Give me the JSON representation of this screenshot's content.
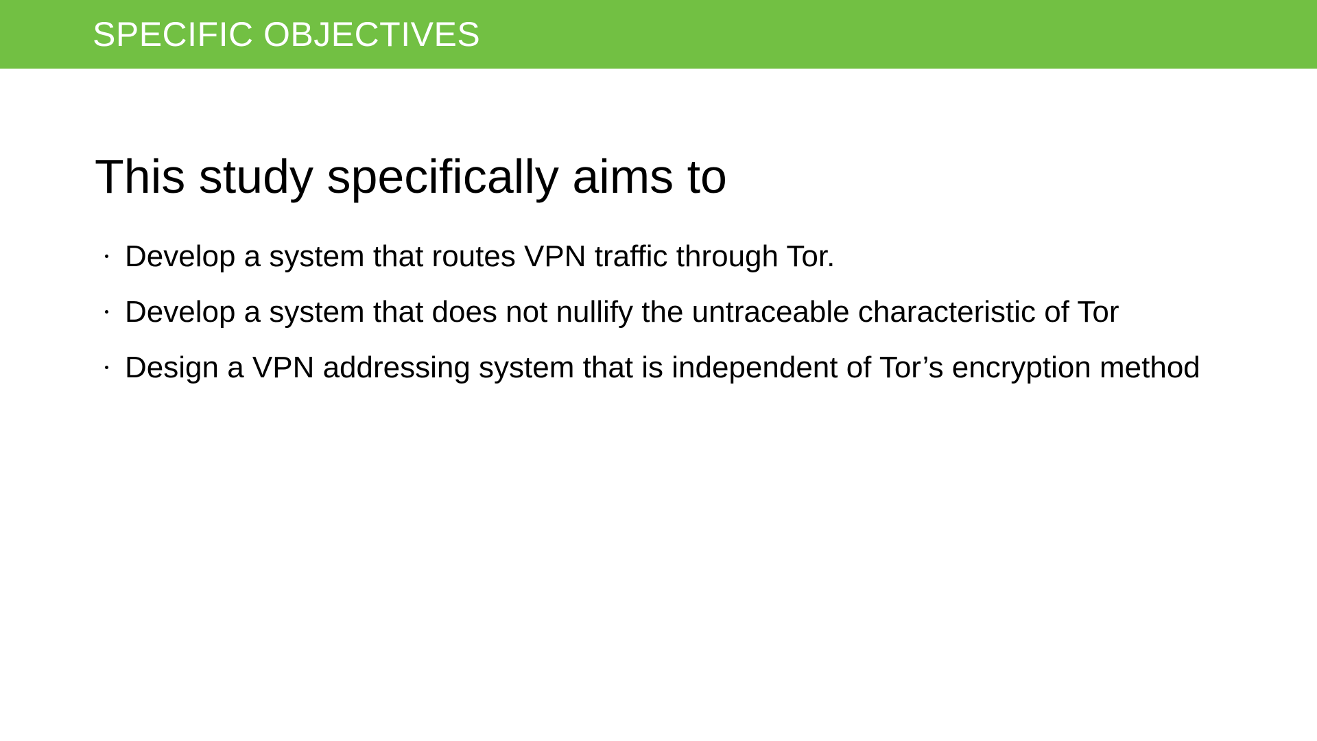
{
  "header": {
    "title": "SPECIFIC OBJECTIVES",
    "color": "#72c043"
  },
  "heading": "This study specifically aims to",
  "bullets": [
    "Develop a system that routes VPN traffic through Tor.",
    "Develop a system that does not nullify the untraceable characteristic of Tor",
    "Design a VPN addressing system that is independent of Tor’s encryption method"
  ]
}
